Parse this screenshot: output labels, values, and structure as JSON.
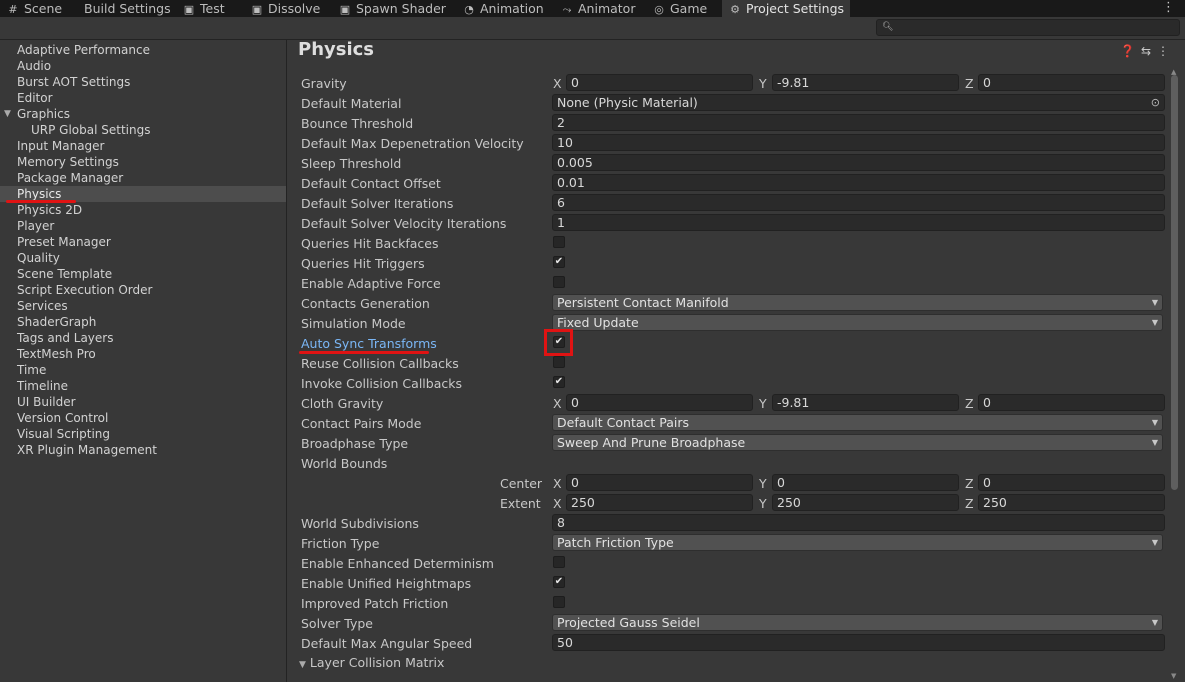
{
  "tabs": [
    {
      "label": "Scene",
      "icon": "grid-icon"
    },
    {
      "label": "Build Settings",
      "icon": ""
    },
    {
      "label": "Test",
      "icon": "save-icon"
    },
    {
      "label": "Dissolve",
      "icon": "save-icon"
    },
    {
      "label": "Spawn Shader",
      "icon": "save-icon"
    },
    {
      "label": "Animation",
      "icon": "animation-icon"
    },
    {
      "label": "Animator",
      "icon": "animator-icon"
    },
    {
      "label": "Game",
      "icon": "gamepad-icon"
    },
    {
      "label": "Project Settings",
      "icon": "gear-icon"
    }
  ],
  "nav": [
    {
      "label": "Adaptive Performance"
    },
    {
      "label": "Audio"
    },
    {
      "label": "Burst AOT Settings"
    },
    {
      "label": "Editor"
    },
    {
      "label": "Graphics",
      "expanded": true
    },
    {
      "label": "URP Global Settings",
      "child": true
    },
    {
      "label": "Input Manager"
    },
    {
      "label": "Memory Settings"
    },
    {
      "label": "Package Manager"
    },
    {
      "label": "Physics",
      "selected": true
    },
    {
      "label": "Physics 2D"
    },
    {
      "label": "Player"
    },
    {
      "label": "Preset Manager"
    },
    {
      "label": "Quality"
    },
    {
      "label": "Scene Template"
    },
    {
      "label": "Script Execution Order"
    },
    {
      "label": "Services"
    },
    {
      "label": "ShaderGraph"
    },
    {
      "label": "Tags and Layers"
    },
    {
      "label": "TextMesh Pro"
    },
    {
      "label": "Time"
    },
    {
      "label": "Timeline"
    },
    {
      "label": "UI Builder"
    },
    {
      "label": "Version Control"
    },
    {
      "label": "Visual Scripting"
    },
    {
      "label": "XR Plugin Management"
    }
  ],
  "page": {
    "title": "Physics"
  },
  "axes": {
    "x": "X",
    "y": "Y",
    "z": "Z"
  },
  "settings": {
    "gravity": {
      "label": "Gravity",
      "x": "0",
      "y": "-9.81",
      "z": "0"
    },
    "default_material": {
      "label": "Default Material",
      "value": "None (Physic Material)"
    },
    "bounce_threshold": {
      "label": "Bounce Threshold",
      "value": "2"
    },
    "max_depenetration": {
      "label": "Default Max Depenetration Velocity",
      "value": "10"
    },
    "sleep_threshold": {
      "label": "Sleep Threshold",
      "value": "0.005"
    },
    "contact_offset": {
      "label": "Default Contact Offset",
      "value": "0.01"
    },
    "solver_iterations": {
      "label": "Default Solver Iterations",
      "value": "6"
    },
    "solver_velocity_iterations": {
      "label": "Default Solver Velocity Iterations",
      "value": "1"
    },
    "queries_hit_backfaces": {
      "label": "Queries Hit Backfaces",
      "checked": false
    },
    "queries_hit_triggers": {
      "label": "Queries Hit Triggers",
      "checked": true
    },
    "adaptive_force": {
      "label": "Enable Adaptive Force",
      "checked": false
    },
    "contacts_generation": {
      "label": "Contacts Generation",
      "value": "Persistent Contact Manifold"
    },
    "simulation_mode": {
      "label": "Simulation Mode",
      "value": "Fixed Update"
    },
    "auto_sync_transforms": {
      "label": "Auto Sync Transforms",
      "checked": true
    },
    "reuse_collision_callbacks": {
      "label": "Reuse Collision Callbacks",
      "checked": false
    },
    "invoke_collision_callbacks": {
      "label": "Invoke Collision Callbacks",
      "checked": true
    },
    "cloth_gravity": {
      "label": "Cloth Gravity",
      "x": "0",
      "y": "-9.81",
      "z": "0"
    },
    "contact_pairs_mode": {
      "label": "Contact Pairs Mode",
      "value": "Default Contact Pairs"
    },
    "broadphase_type": {
      "label": "Broadphase Type",
      "value": "Sweep And Prune Broadphase"
    },
    "world_bounds": {
      "label": "World Bounds"
    },
    "center": {
      "label": "Center",
      "x": "0",
      "y": "0",
      "z": "0"
    },
    "extent": {
      "label": "Extent",
      "x": "250",
      "y": "250",
      "z": "250"
    },
    "world_subdivisions": {
      "label": "World Subdivisions",
      "value": "8"
    },
    "friction_type": {
      "label": "Friction Type",
      "value": "Patch Friction Type"
    },
    "enhanced_determinism": {
      "label": "Enable Enhanced Determinism",
      "checked": false
    },
    "unified_heightmaps": {
      "label": "Enable Unified Heightmaps",
      "checked": true
    },
    "improved_patch_friction": {
      "label": "Improved Patch Friction",
      "checked": false
    },
    "solver_type": {
      "label": "Solver Type",
      "value": "Projected Gauss Seidel"
    },
    "max_angular_speed": {
      "label": "Default Max Angular Speed",
      "value": "50"
    }
  },
  "layer_collision_matrix": {
    "label": "Layer Collision Matrix"
  },
  "colors": {
    "annotation_red": "#e01313",
    "link_blue": "#7ab6f5",
    "selection": "#4d4d4d"
  }
}
